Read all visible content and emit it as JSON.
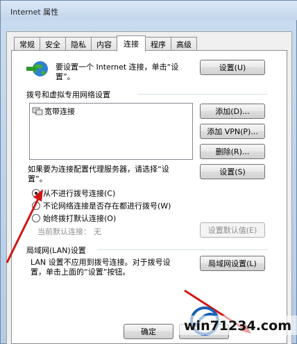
{
  "window": {
    "title": "Internet 属性"
  },
  "tabs": [
    {
      "label": "常规"
    },
    {
      "label": "安全"
    },
    {
      "label": "隐私"
    },
    {
      "label": "内容"
    },
    {
      "label": "连接"
    },
    {
      "label": "程序"
    },
    {
      "label": "高级"
    }
  ],
  "setup": {
    "text_line1": "要设置一个 Internet 连接，单击“设",
    "text_line2": "置”。",
    "button": "设置(U)"
  },
  "dialup": {
    "section_label": "拨号和虚拟专用网络设置",
    "list_items": [
      "宽带连接"
    ],
    "add_button": "添加(D)...",
    "add_vpn_button": "添加 VPN(P)...",
    "delete_button": "删除(R)...",
    "proxy_text_line1": "如果要为连接配置代理服务器，请选择“设",
    "proxy_text_line2": "置”。",
    "settings_button": "设置(S)",
    "radio_never": "从不进行拨号连接(C)",
    "radio_no_network": "不论网络连接是否存在都进行拨号(W)",
    "radio_always": "始终拨打默认连接(O)",
    "current_default_label": "当前默认连接：",
    "current_default_value": "无",
    "set_default_button": "设置默认值(E)"
  },
  "lan": {
    "section_label": "局域网(LAN)设置",
    "text_line1": "LAN 设置不应用到拨号连接。对于拨号设",
    "text_line2": "置，单击上面的“设置”按钮。",
    "button": "局域网设置(L)"
  },
  "footer": {
    "ok_button": "确定"
  },
  "watermark": {
    "text": "win71234.com"
  },
  "colors": {
    "arrow": "#d11515",
    "watermark_blue": "#1a5fb4"
  }
}
